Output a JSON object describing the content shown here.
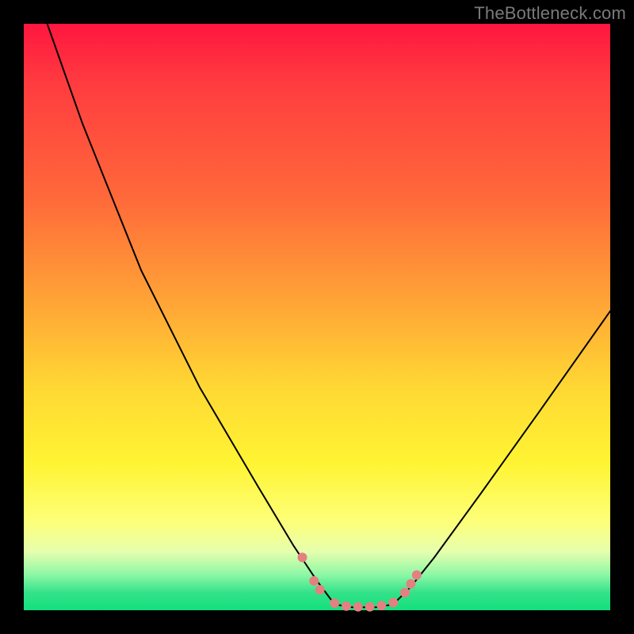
{
  "watermark": "TheBottleneck.com",
  "chart_data": {
    "type": "line",
    "title": "",
    "xlabel": "",
    "ylabel": "",
    "xlim": [
      0,
      100
    ],
    "ylim": [
      0,
      100
    ],
    "note": "Bottleneck-style V curve; x is an unlabeled parameter axis, y is bottleneck %. Color gradient background: red (high) at top to green (low) at bottom. Minimum (~0) around x=55-60; left branch reaches y=100 at x≈4; right branch reaches y≈51 at x=100. Pink dot markers cluster near the minimum.",
    "series": [
      {
        "name": "curve-left",
        "x": [
          4,
          10,
          20,
          30,
          40,
          46,
          50,
          53
        ],
        "values": [
          100,
          83,
          58,
          38,
          21,
          11,
          5,
          1
        ]
      },
      {
        "name": "curve-flat",
        "x": [
          53,
          56,
          60,
          63
        ],
        "values": [
          1,
          0.5,
          0.5,
          1
        ]
      },
      {
        "name": "curve-right",
        "x": [
          63,
          66,
          70,
          78,
          88,
          100
        ],
        "values": [
          1,
          4,
          9,
          20,
          34,
          51
        ]
      }
    ],
    "markers": {
      "name": "highlight-dots",
      "color": "#e48080",
      "points": [
        {
          "x": 47.5,
          "y": 9
        },
        {
          "x": 49.5,
          "y": 5
        },
        {
          "x": 50.5,
          "y": 3.5
        },
        {
          "x": 53,
          "y": 1.2
        },
        {
          "x": 55,
          "y": 0.7
        },
        {
          "x": 57,
          "y": 0.6
        },
        {
          "x": 59,
          "y": 0.6
        },
        {
          "x": 61,
          "y": 0.8
        },
        {
          "x": 63,
          "y": 1.3
        },
        {
          "x": 65,
          "y": 3
        },
        {
          "x": 66,
          "y": 4.5
        },
        {
          "x": 67,
          "y": 6
        }
      ]
    }
  }
}
